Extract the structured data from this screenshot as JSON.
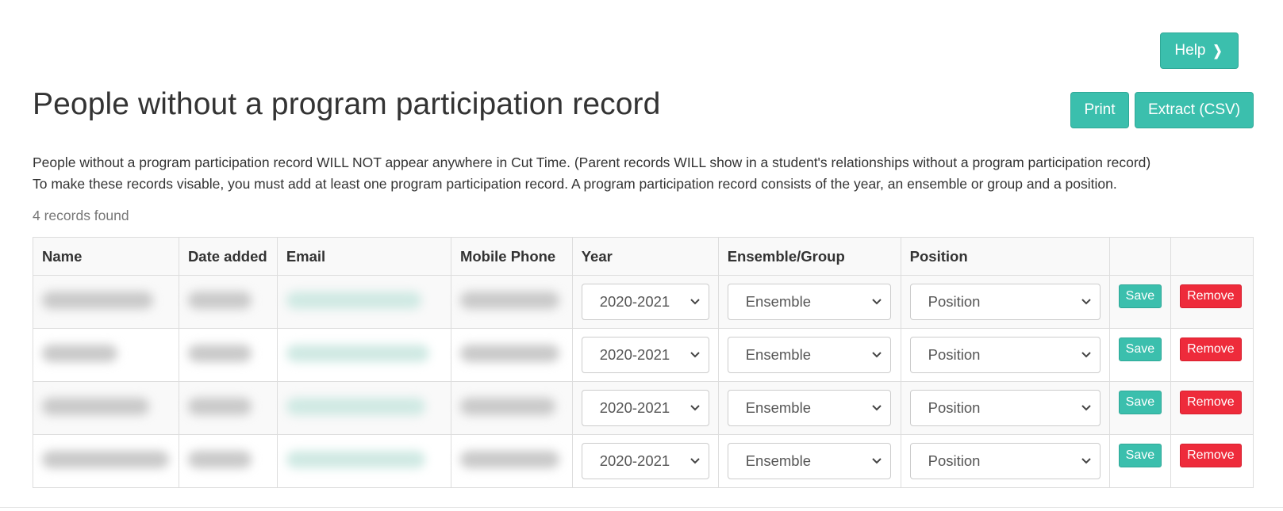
{
  "buttons": {
    "help": "Help",
    "print": "Print",
    "extract": "Extract (CSV)"
  },
  "page": {
    "title": "People without a program participation record",
    "desc_line1": "People without a program participation record WILL NOT appear anywhere in Cut Time. (Parent records WILL show in a student's relationships without a program participation record)",
    "desc_line2": "To make these records visable, you must add at least one program participation record. A program participation record consists of the year, an ensemble or group and a position.",
    "count": "4 records found"
  },
  "table": {
    "headers": [
      "Name",
      "Date added",
      "Email",
      "Mobile Phone",
      "Year",
      "Ensemble/Group",
      "Position",
      "",
      ""
    ],
    "rows": [
      {
        "year": "2020-2021",
        "ensemble": "Ensemble",
        "position": "Position",
        "save": "Save",
        "remove": "Remove"
      },
      {
        "year": "2020-2021",
        "ensemble": "Ensemble",
        "position": "Position",
        "save": "Save",
        "remove": "Remove"
      },
      {
        "year": "2020-2021",
        "ensemble": "Ensemble",
        "position": "Position",
        "save": "Save",
        "remove": "Remove"
      },
      {
        "year": "2020-2021",
        "ensemble": "Ensemble",
        "position": "Position",
        "save": "Save",
        "remove": "Remove"
      }
    ]
  },
  "colors": {
    "accent": "#3bbfad",
    "danger": "#ee2b3b",
    "text": "#333333",
    "muted": "#777777"
  }
}
